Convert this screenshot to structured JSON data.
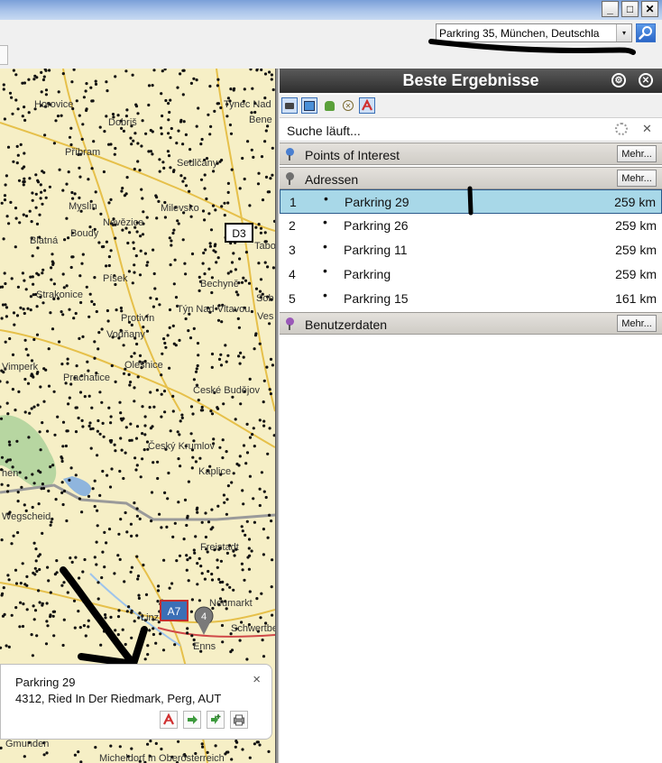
{
  "window": {
    "minimize_glyph": "_",
    "maximize_glyph": "□",
    "close_glyph": "✕"
  },
  "search": {
    "value": "Parkring 35, München, Deutschla",
    "dropdown_glyph": "▾"
  },
  "panel": {
    "title": "Beste Ergebnisse",
    "status": "Suche läuft...",
    "cancel_glyph": "✕",
    "groups": [
      {
        "label": "Points of Interest",
        "more": "Mehr...",
        "pin_color": "#4a7fd0"
      },
      {
        "label": "Adressen",
        "more": "Mehr...",
        "pin_color": "#6f6f6f"
      },
      {
        "label": "Benutzerdaten",
        "more": "Mehr...",
        "pin_color": "#9a58b8"
      }
    ],
    "results": [
      {
        "num": "1",
        "bullet": "•",
        "name": "Parkring 29",
        "dist": "259 km",
        "selected": true
      },
      {
        "num": "2",
        "bullet": "•",
        "name": "Parkring 26",
        "dist": "259 km"
      },
      {
        "num": "3",
        "bullet": "•",
        "name": "Parkring 11",
        "dist": "259 km"
      },
      {
        "num": "4",
        "bullet": "•",
        "name": "Parkring",
        "dist": "259 km"
      },
      {
        "num": "5",
        "bullet": "•",
        "name": "Parkring 15",
        "dist": "161 km"
      }
    ]
  },
  "map": {
    "labels": [
      "Horovice",
      "Dobriš",
      "Tynec Nad",
      "Bene",
      "Příbram",
      "Sedlčany",
      "Myslín",
      "Nevězice",
      "Boudy",
      "Milevsko",
      "Tabo",
      "Blatná",
      "Písek",
      "Bechyně",
      "Strakonice",
      "Sob",
      "Protivín",
      "Týn Nad Vltavou",
      "Ves",
      "Vodňany",
      "Vimperk",
      "Prachatice",
      "Olešnice",
      "České Budějov",
      "Český Krumlov",
      "Kaplice",
      "hen",
      "Wegscheid",
      "Freistadt",
      "Linz",
      "Enns",
      "Schwertbe",
      "Neumarkt",
      "Gmunden",
      "Micheldorf In Oberösterreich"
    ],
    "road_shields": [
      "D3",
      "A7"
    ],
    "marker_number": "4"
  },
  "popup": {
    "name": "Parkring 29",
    "address": "4312, Ried In Der Riedmark, Perg, AUT",
    "close_glyph": "×"
  }
}
